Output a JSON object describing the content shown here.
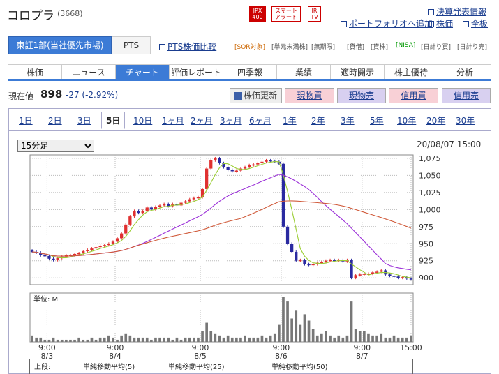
{
  "header": {
    "stock_name": "コロプラ",
    "stock_code": "(3668)",
    "badges": [
      {
        "line1": "JPX",
        "line2": "400",
        "style": "red"
      },
      {
        "line1": "スマート",
        "line2": "アラート",
        "style": "outline"
      },
      {
        "line1": "IR",
        "line2": "TV",
        "style": "outline"
      }
    ],
    "links": {
      "earnings": "決算発表情報",
      "portfolio": "ポートフォリオへ追加",
      "stock_price": "株価",
      "board": "全板"
    }
  },
  "market": {
    "primary": "東証1部(当社優先市場)",
    "pts": "PTS",
    "pts_compare": "PTS株価比較",
    "tags": [
      "[SOR対象]",
      "[単元未満株]",
      "[無期限]",
      "[貸借]",
      "[貸株]",
      "[NISA]",
      "[日計り買]",
      "[日計り売]"
    ]
  },
  "tabs": [
    "株価",
    "ニュース",
    "チャート",
    "評価レポート",
    "四季報",
    "業績",
    "適時開示",
    "株主優待",
    "分析"
  ],
  "active_tab": 2,
  "quote": {
    "label": "現在値",
    "price": "898",
    "change": "-27 (-2.92%)"
  },
  "actions": {
    "refresh": "株価更新",
    "genbuy": "現物買",
    "gensell": "現物売",
    "shinbuy": "信用買",
    "shinsell": "信用売"
  },
  "periods": [
    "1日",
    "2日",
    "3日",
    "5日",
    "10日",
    "1ヶ月",
    "2ヶ月",
    "3ヶ月",
    "6ヶ月",
    "1年",
    "2年",
    "3年",
    "5年",
    "10年",
    "20年",
    "30年"
  ],
  "active_period": 3,
  "interval": {
    "selected": "15分足"
  },
  "timestamp": "20/08/07 15:00",
  "colors": {
    "up": "#e03030",
    "down": "#2a2aa0",
    "ma5": "#9acd32",
    "ma25": "#9b30d8",
    "ma50": "#d05a3a",
    "grid": "#bbbbbb"
  },
  "chart_data": {
    "type": "candlestick",
    "y_ticks": [
      "1,075",
      "1,050",
      "1,025",
      "1,000",
      "975",
      "950",
      "925",
      "900"
    ],
    "ylim": [
      890,
      1080
    ],
    "x_ticks": [
      {
        "time": "9:00",
        "date": "8/3"
      },
      {
        "time": "9:00",
        "date": "8/4"
      },
      {
        "time": "9:00",
        "date": "8/5"
      },
      {
        "time": "9:00",
        "date": "8/6"
      },
      {
        "time": "9:00",
        "date": "8/7"
      },
      {
        "time": "15:00",
        "date": ""
      }
    ],
    "volume_label": "単位: M",
    "closes": [
      938,
      937,
      933,
      932,
      928,
      926,
      929,
      931,
      933,
      933,
      935,
      936,
      939,
      941,
      943,
      945,
      947,
      948,
      950,
      953,
      958,
      965,
      978,
      990,
      998,
      995,
      998,
      1003,
      1000,
      1004,
      1006,
      1008,
      1005,
      1008,
      1006,
      1010,
      1012,
      1015,
      1017,
      1018,
      1030,
      1060,
      1072,
      1075,
      1068,
      1062,
      1058,
      1056,
      1057,
      1060,
      1062,
      1065,
      1066,
      1068,
      1070,
      1072,
      1071,
      1070,
      1067,
      975,
      950,
      938,
      925,
      926,
      920,
      919,
      920,
      922,
      923,
      925,
      926,
      925,
      926,
      924,
      926,
      900,
      904,
      905,
      906,
      906,
      908,
      909,
      911,
      905,
      903,
      902,
      900,
      901,
      899,
      898
    ],
    "volumes": [
      3,
      2,
      2,
      1,
      1,
      2,
      1,
      1,
      1,
      1,
      1,
      2,
      1,
      1,
      2,
      1,
      2,
      2,
      3,
      2,
      1,
      3,
      4,
      3,
      2,
      2,
      2,
      2,
      1,
      2,
      2,
      2,
      2,
      1,
      2,
      1,
      2,
      2,
      2,
      2,
      5,
      9,
      5,
      4,
      3,
      2,
      3,
      2,
      2,
      2,
      3,
      2,
      2,
      2,
      3,
      2,
      3,
      4,
      8,
      21,
      19,
      11,
      15,
      8,
      13,
      10,
      6,
      3,
      4,
      5,
      3,
      2,
      3,
      2,
      3,
      19,
      6,
      5,
      5,
      4,
      3,
      3,
      4,
      2,
      2,
      3,
      2,
      2,
      2,
      3
    ],
    "ma_series": [
      {
        "name": "単純移動平均(5)",
        "window": 5
      },
      {
        "name": "単純移動平均(25)",
        "window": 25
      },
      {
        "name": "単純移動平均(50)",
        "window": 50
      }
    ]
  },
  "legend": {
    "prefix": "上段:"
  }
}
